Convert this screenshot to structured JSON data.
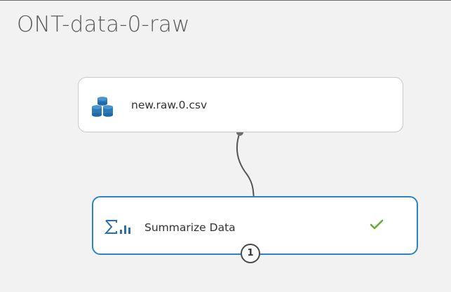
{
  "experiment": {
    "title": "ONT-data-0-raw"
  },
  "modules": {
    "dataset": {
      "label": "new.raw.0.csv",
      "icon": "database-icon"
    },
    "summarize": {
      "label": "Summarize Data",
      "icon": "sigma-chart-icon",
      "status_icon": "checkmark-icon",
      "output_port": "1"
    }
  },
  "colors": {
    "canvas_background": "#f2f2f2",
    "selected_border": "#2b84c6",
    "success_check": "#6aaa3a",
    "dataset_icon": "#2a7ab8"
  }
}
